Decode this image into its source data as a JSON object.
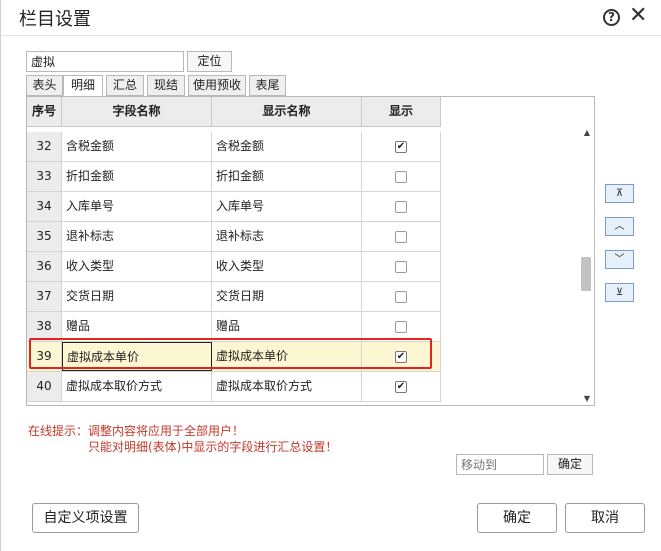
{
  "dialog": {
    "title": "栏目设置"
  },
  "search": {
    "value": "虚拟",
    "locate_label": "定位"
  },
  "tabs": [
    {
      "label": "表头"
    },
    {
      "label": "明细",
      "active": true
    },
    {
      "label": "汇总"
    },
    {
      "label": "现结"
    },
    {
      "label": "使用预收"
    },
    {
      "label": "表尾"
    }
  ],
  "table": {
    "headers": [
      "序号",
      "字段名称",
      "显示名称",
      "显示"
    ],
    "rows": [
      {
        "seq": "32",
        "field": "含税金额",
        "display": "含税金额",
        "show": true
      },
      {
        "seq": "33",
        "field": "折扣金额",
        "display": "折扣金额",
        "show": false
      },
      {
        "seq": "34",
        "field": "入库单号",
        "display": "入库单号",
        "show": false
      },
      {
        "seq": "35",
        "field": "退补标志",
        "display": "退补标志",
        "show": false
      },
      {
        "seq": "36",
        "field": "收入类型",
        "display": "收入类型",
        "show": false
      },
      {
        "seq": "37",
        "field": "交货日期",
        "display": "交货日期",
        "show": false
      },
      {
        "seq": "38",
        "field": "赠品",
        "display": "赠品",
        "show": false
      },
      {
        "seq": "39",
        "field": "虚拟成本单价",
        "display": "虚拟成本单价",
        "show": true,
        "selected": true
      },
      {
        "seq": "40",
        "field": "虚拟成本取价方式",
        "display": "虚拟成本取价方式",
        "show": true
      }
    ]
  },
  "order_buttons": [
    {
      "name": "move-top-button",
      "icon": "⊼"
    },
    {
      "name": "move-up-button",
      "icon": "︿"
    },
    {
      "name": "move-down-button",
      "icon": "﹀"
    },
    {
      "name": "move-bottom-button",
      "icon": "⊻"
    }
  ],
  "hints": {
    "line1": "在线提示：调整内容将应用于全部用户！",
    "line2": "只能对明细(表体)中显示的字段进行汇总设置！"
  },
  "moveto": {
    "placeholder": "移动到",
    "confirm_label": "确定"
  },
  "footer": {
    "custom_label": "自定义项设置",
    "ok_label": "确定",
    "cancel_label": "取消"
  },
  "colors": {
    "highlight_border": "#e0261f",
    "highlight_row": "#fdf6d3",
    "hint_text": "#c0392b"
  }
}
